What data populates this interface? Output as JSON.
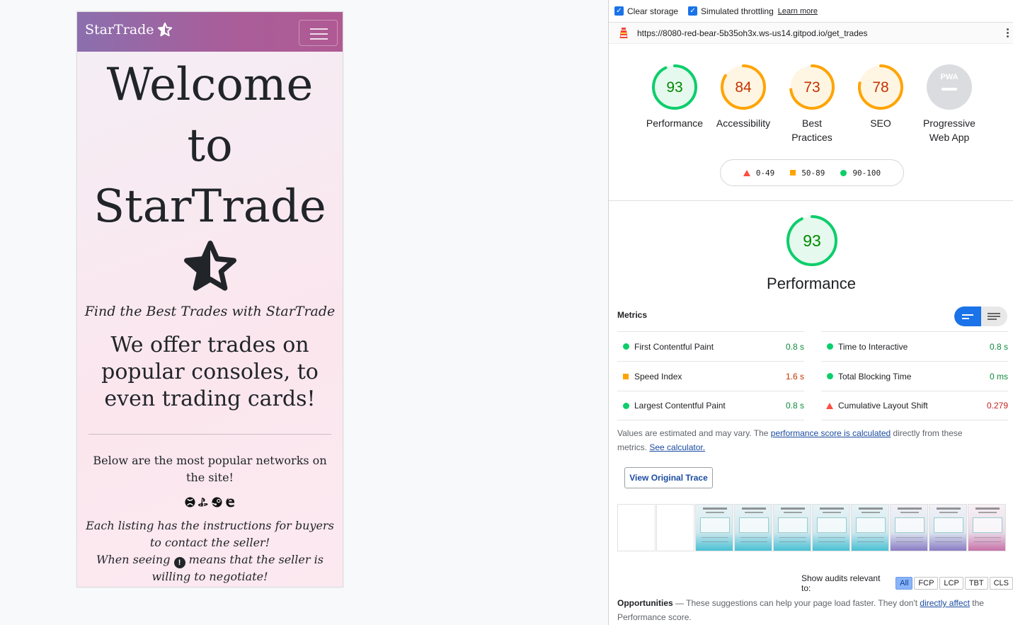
{
  "site": {
    "brand": "StarTrade",
    "hero_line1": "Welcome",
    "hero_line2": "to",
    "hero_line3": "StarTrade",
    "tagline": "Find the Best Trades with StarTrade",
    "offer": "We offer trades on popular consoles, to even trading cards!",
    "networks_text": "Below are the most popular networks on the site!",
    "network_icons": [
      "xbox-icon",
      "playstation-icon",
      "steam-icon",
      "edge-icon"
    ],
    "instructions_line1": "Each listing has the instructions for buyers to contact the seller!",
    "instructions_line2a": "When seeing",
    "instructions_line2b": "means that the seller is",
    "instructions_line3": "willing to negotiate!"
  },
  "lighthouse": {
    "toolbar": {
      "clear_storage": "Clear storage",
      "clear_storage_checked": true,
      "throttling": "Simulated throttling",
      "throttling_checked": true,
      "learn_more": "Learn more"
    },
    "url": "https://8080-red-bear-5b35oh3x.ws-us14.gitpod.io/get_trades",
    "categories": [
      {
        "label": "Performance",
        "score": 93,
        "rating": "pass"
      },
      {
        "label": "Accessibility",
        "score": 84,
        "rating": "average"
      },
      {
        "label": "Best Practices",
        "score": 73,
        "rating": "average"
      },
      {
        "label": "SEO",
        "score": 78,
        "rating": "average"
      },
      {
        "label": "Progressive Web App",
        "score": null,
        "rating": "na",
        "badge": "PWA"
      }
    ],
    "legend": {
      "fail": "0-49",
      "average": "50-89",
      "pass": "90-100"
    },
    "performance": {
      "score": 93,
      "title": "Performance",
      "metrics_heading": "Metrics",
      "metrics_left": [
        {
          "name": "First Contentful Paint",
          "value": "0.8 s",
          "rating": "pass"
        },
        {
          "name": "Speed Index",
          "value": "1.6 s",
          "rating": "average"
        },
        {
          "name": "Largest Contentful Paint",
          "value": "0.8 s",
          "rating": "pass"
        }
      ],
      "metrics_right": [
        {
          "name": "Time to Interactive",
          "value": "0.8 s",
          "rating": "pass"
        },
        {
          "name": "Total Blocking Time",
          "value": "0 ms",
          "rating": "pass"
        },
        {
          "name": "Cumulative Layout Shift",
          "value": "0.279",
          "rating": "fail"
        }
      ],
      "note_pre": "Values are estimated and may vary. The ",
      "note_link1": "performance score is calculated",
      "note_mid": " directly from these metrics. ",
      "note_link2": "See calculator.",
      "trace_button": "View Original Trace",
      "filter_label": "Show audits relevant to:",
      "filters": [
        "All",
        "FCP",
        "LCP",
        "TBT",
        "CLS"
      ],
      "active_filter": "All",
      "opps_title": "Opportunities",
      "opps_pre": " — These suggestions can help your page load faster. They don't ",
      "opps_link": "directly affect",
      "opps_post": " the Performance score."
    },
    "colors": {
      "pass": "#0cce6b",
      "average": "#ffa400",
      "fail": "#ff4e42",
      "accent": "#1a73e8"
    }
  }
}
